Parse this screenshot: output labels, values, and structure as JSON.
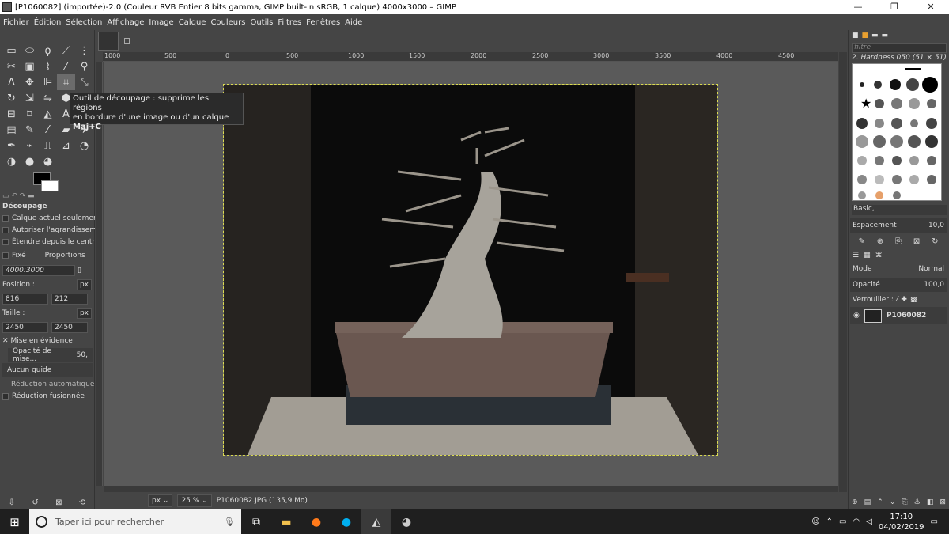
{
  "window": {
    "title": "[P1060082] (importée)-2.0 (Couleur RVB Entier 8 bits gamma, GIMP built-in sRGB, 1 calque) 4000x3000 – GIMP",
    "minimize": "—",
    "restore": "❐",
    "close": "✕"
  },
  "menu": [
    "Fichier",
    "Édition",
    "Sélection",
    "Affichage",
    "Image",
    "Calque",
    "Couleurs",
    "Outils",
    "Filtres",
    "Fenêtres",
    "Aide"
  ],
  "tooltip": {
    "line1": "Outil de découpage : supprime les régions",
    "line2": "en bordure d'une image ou d'un calque",
    "shortcut": "Maj+C"
  },
  "tool_options": {
    "title": "Découpage",
    "current_layer": "Calque actuel seulement",
    "allow_grow": "Autoriser l'agrandissement",
    "expand_center": "Étendre depuis le centre",
    "fixed": "Fixé",
    "proportions": "Proportions",
    "ratio": "4000:3000",
    "position_label": "Position :",
    "unit": "px",
    "pos_x": "816",
    "pos_y": "212",
    "size_label": "Taille :",
    "size_w": "2450",
    "size_h": "2450",
    "highlight": "Mise en évidence",
    "highlight_opacity_label": "Opacité de mise...",
    "highlight_opacity_value": "50,",
    "guides": "Aucun guide",
    "auto_shrink": "Réduction automatique",
    "shrink_merged": "Réduction fusionnée"
  },
  "ruler_ticks": [
    "1000",
    "500",
    "0",
    "500",
    "1000",
    "1500",
    "2000",
    "2500",
    "3000",
    "3500",
    "4000",
    "4500"
  ],
  "status": {
    "unit": "px",
    "zoom": "25 %",
    "file": "P1060082.JPG (135,9 Mo)"
  },
  "brushes": {
    "filter_placeholder": "filtre",
    "current": "2. Hardness 050 (51 × 51)",
    "preset": "Basic,",
    "spacing_label": "Espacement",
    "spacing_value": "10,0"
  },
  "layers": {
    "mode_label": "Mode",
    "mode_value": "Normal",
    "opacity_label": "Opacité",
    "opacity_value": "100,0",
    "lock_label": "Verrouiller :",
    "layer_name": "P1060082"
  },
  "taskbar": {
    "search_placeholder": "Taper ici pour rechercher",
    "time": "17:10",
    "date": "04/02/2019"
  }
}
